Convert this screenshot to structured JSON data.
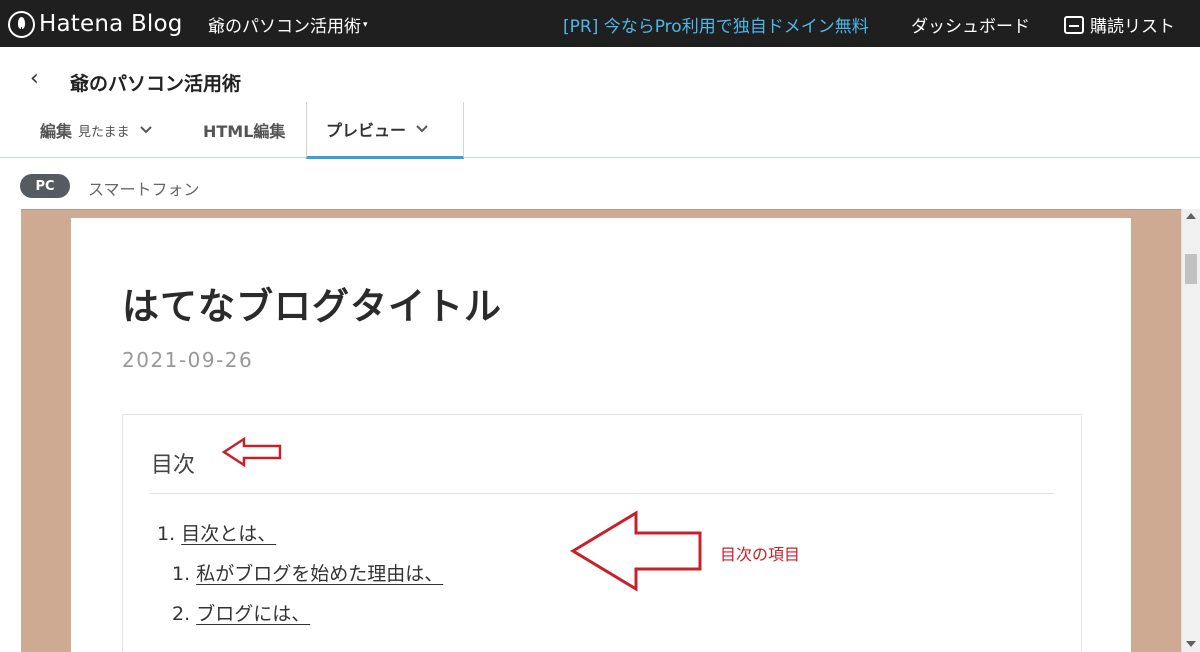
{
  "topbar": {
    "logo_text": "Hatena Blog",
    "blog_name": "爺のパソコン活用術",
    "blog_caret": "▾",
    "promo": "[PR] 今ならPro利用で独自ドメイン無料",
    "dashboard": "ダッシュボード",
    "reader": "購読リスト"
  },
  "editor": {
    "back": "‹",
    "blog_title": "爺のパソコン活用術",
    "tabs": {
      "edit_label": "編集",
      "edit_mode": "見たまま",
      "html_label": "HTML編集",
      "preview_label": "プレビュー",
      "chevron": "⌄"
    }
  },
  "device": {
    "pc": "PC",
    "smartphone": "スマートフォン"
  },
  "post": {
    "title": "はてなブログタイトル",
    "date": "2021-09-26",
    "toc": {
      "title": "目次",
      "items": [
        {
          "num": "1.",
          "text": "目次とは、"
        },
        {
          "num": "1.",
          "text": "私がブログを始めた理由は、"
        },
        {
          "num": "2.",
          "text": "ブログには、"
        }
      ]
    }
  },
  "annotation": {
    "label": "目次の項目",
    "color": "#c8202a"
  },
  "colors": {
    "topbar_bg": "#1f1f1f",
    "promo": "#4fb7e8",
    "preview_bg": "#cfaa92",
    "tab_active": "#3aa0d8"
  }
}
